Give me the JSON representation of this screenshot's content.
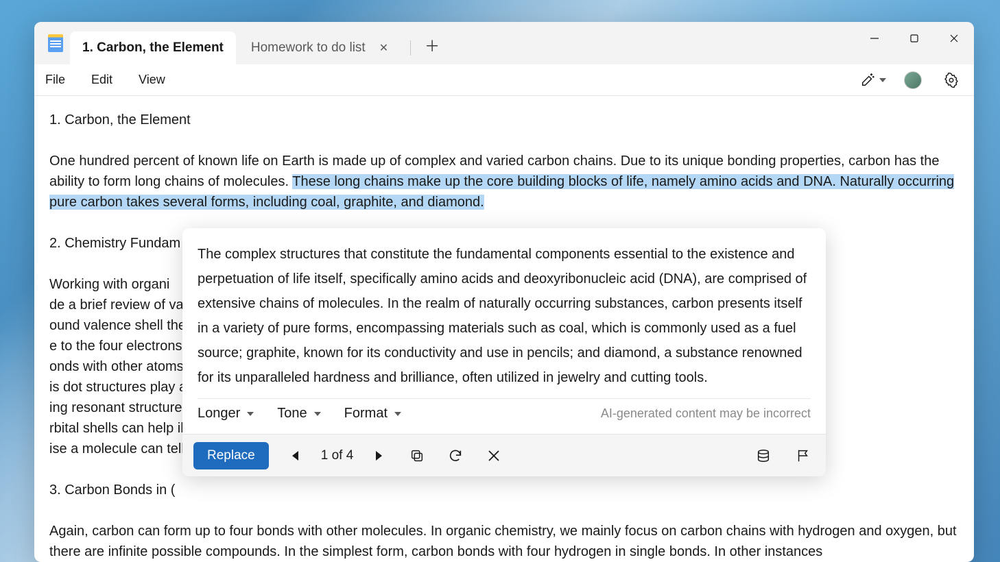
{
  "tabs": {
    "active": "1. Carbon, the Element",
    "inactive": "Homework to do list"
  },
  "menu": {
    "file": "File",
    "edit": "Edit",
    "view": "View"
  },
  "doc": {
    "h1": "1. Carbon, the Element",
    "p1a": "One hundred percent of known life on Earth is made up of complex and varied carbon chains. Due to its unique bonding properties, carbon has the ability to form long chains of molecules. ",
    "p1b": "These long chains make up the core building blocks of life, namely amino acids and DNA. Naturally occurring pure carbon takes several forms, including coal, graphite, and diamond.",
    "h2": "2. Chemistry Fundam",
    "p2": "Working with organi                                                                                                                                                                                                                de a brief review of valence shell theory,                                                                                                                                                                                                             ound valence shell theory—the idea tha                                                                                                                                                                                                              e to the four electrons in its outer                                                                                                                                                                                                                  onds with other atoms or molecules.                                                                                                                                                                                                               is dot structures play a pivotal role in                                                                                                                                                                                                                 ing resonant structures) can help                                                                                                                                                                                                                rbital shells can help illuminate the event                                                                                                                                                                                                              ise a molecule can tell us its basic shape",
    "h3": "3. Carbon Bonds in (",
    "p3": "Again, carbon can form up to four bonds with other molecules. In organic chemistry, we mainly focus on carbon chains with hydrogen and oxygen, but there are infinite possible compounds. In the simplest form, carbon bonds with four hydrogen in single bonds. In other instances"
  },
  "ai": {
    "body": "The complex structures that constitute the fundamental components essential to the existence and perpetuation of life itself, specifically amino acids and deoxyribonucleic acid (DNA), are comprised of extensive chains of molecules. In the realm of naturally occurring substances, carbon presents itself in a variety of pure forms, encompassing materials such as coal, which is commonly used as a fuel source; graphite, known for its conductivity and use in pencils; and diamond, a substance renowned for its unparalleled hardness and brilliance, often utilized in jewelry and cutting tools.",
    "opt_longer": "Longer",
    "opt_tone": "Tone",
    "opt_format": "Format",
    "disclaimer": "AI-generated content may be incorrect",
    "replace": "Replace",
    "counter": "1 of 4"
  }
}
